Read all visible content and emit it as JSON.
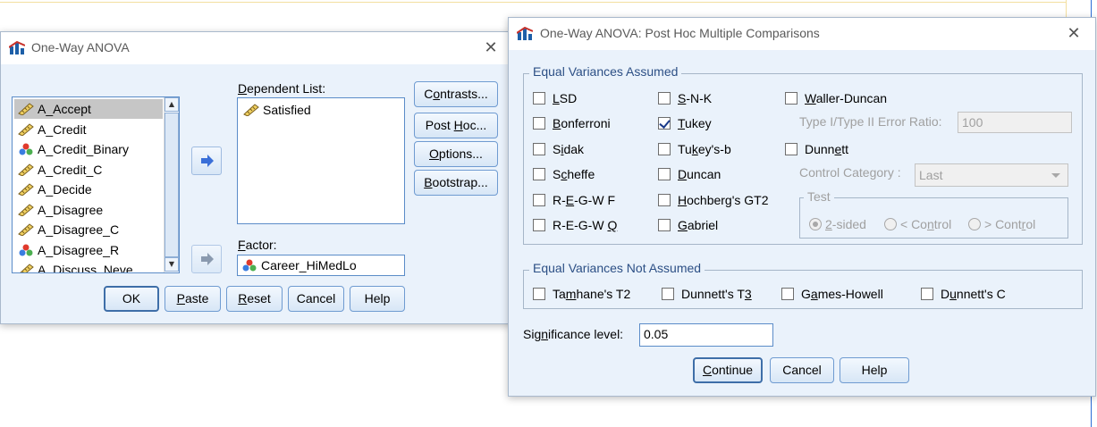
{
  "main_dialog": {
    "title": "One-Way ANOVA",
    "variables": [
      {
        "name": "A_Accept",
        "icon": "scale-ruler-icon",
        "selected": true
      },
      {
        "name": "A_Credit",
        "icon": "scale-ruler-icon"
      },
      {
        "name": "A_Credit_Binary",
        "icon": "nominal-balls-icon"
      },
      {
        "name": "A_Credit_C",
        "icon": "scale-ruler-icon"
      },
      {
        "name": "A_Decide",
        "icon": "scale-ruler-icon"
      },
      {
        "name": "A_Disagree",
        "icon": "scale-ruler-icon"
      },
      {
        "name": "A_Disagree_C",
        "icon": "scale-ruler-icon"
      },
      {
        "name": "A_Disagree_R",
        "icon": "nominal-balls-icon"
      },
      {
        "name": "A_Discuss_Neve",
        "icon": "scale-ruler-icon"
      }
    ],
    "dependent_list_label": "Dependent List:",
    "dependent_list_items": [
      {
        "name": "Satisfied",
        "icon": "scale-ruler-icon"
      }
    ],
    "factor_label": "Factor:",
    "factor_value": "Career_HiMedLo",
    "side_buttons": [
      "Contrasts...",
      "Post Hoc...",
      "Options...",
      "Bootstrap..."
    ],
    "bottom_buttons": [
      "OK",
      "Paste",
      "Reset",
      "Cancel",
      "Help"
    ]
  },
  "posthoc_dialog": {
    "title": "One-Way ANOVA: Post Hoc Multiple Comparisons",
    "equal_assumed_title": "Equal Variances Assumed",
    "col1": [
      {
        "label": "LSD",
        "checked": false
      },
      {
        "label": "Bonferroni",
        "checked": false
      },
      {
        "label": "Sidak",
        "checked": false
      },
      {
        "label": "Scheffe",
        "checked": false
      },
      {
        "label": "R-E-G-W F",
        "checked": false
      },
      {
        "label": "R-E-G-W Q",
        "checked": false
      }
    ],
    "col2": [
      {
        "label": "S-N-K",
        "checked": false
      },
      {
        "label": "Tukey",
        "checked": true
      },
      {
        "label": "Tukey's-b",
        "checked": false
      },
      {
        "label": "Duncan",
        "checked": false
      },
      {
        "label": "Hochberg's GT2",
        "checked": false
      },
      {
        "label": "Gabriel",
        "checked": false
      }
    ],
    "waller_duncan": "Waller-Duncan",
    "error_ratio_label": "Type I/Type II Error Ratio:",
    "error_ratio_value": "100",
    "dunnett": "Dunnett",
    "control_category_label": "Control Category :",
    "control_category_value": "Last",
    "test_title": "Test",
    "test_options": [
      "2-sided",
      "< Control",
      "> Control"
    ],
    "equal_not_assumed_title": "Equal Variances Not Assumed",
    "not_assumed": [
      "Tamhane's T2",
      "Dunnett's T3",
      "Games-Howell",
      "Dunnett's C"
    ],
    "significance_label": "Significance level:",
    "significance_value": "0.05",
    "buttons": [
      "Continue",
      "Cancel",
      "Help"
    ]
  }
}
